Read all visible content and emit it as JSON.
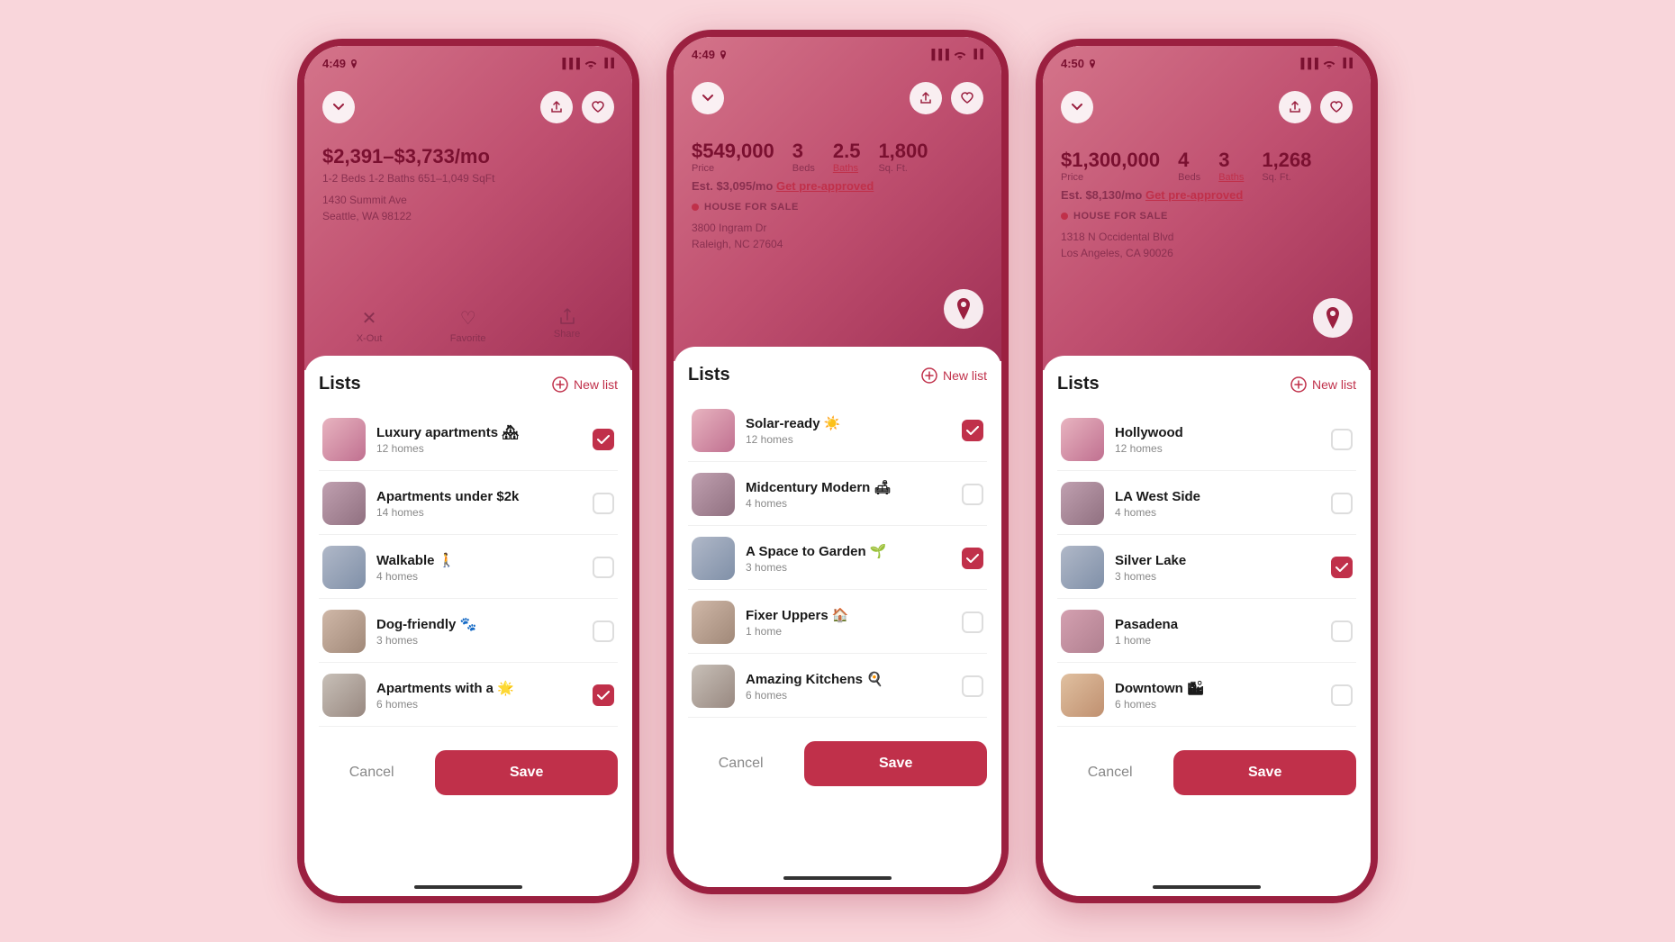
{
  "phones": [
    {
      "id": "phone-left",
      "status_time": "4:49",
      "property": {
        "price": "$2,391–$3,733/mo",
        "details": "1-2 Beds   1-2 Baths   651–1,049 SqFt",
        "address_line1": "1430 Summit Ave",
        "address_line2": "Seattle, WA 98122",
        "show_stats": false,
        "show_house_tag": false
      },
      "lists_title": "Lists",
      "new_list_label": "New list",
      "items": [
        {
          "name": "Luxury apartments 🏘",
          "count": "12 homes",
          "checked": true,
          "thumb": "thumb-gradient-1"
        },
        {
          "name": "Apartments under $2k",
          "count": "14 homes",
          "checked": false,
          "thumb": "thumb-gradient-2"
        },
        {
          "name": "Walkable 🚶",
          "count": "4 homes",
          "checked": false,
          "thumb": "thumb-gradient-3"
        },
        {
          "name": "Dog-friendly 🐾",
          "count": "3 homes",
          "checked": false,
          "thumb": "thumb-gradient-4"
        },
        {
          "name": "Apartments with a 🌟",
          "count": "6 homes",
          "checked": true,
          "thumb": "thumb-gradient-5"
        }
      ],
      "cancel_label": "Cancel",
      "save_label": "Save"
    },
    {
      "id": "phone-middle",
      "status_time": "4:49",
      "property": {
        "price": "$549,000",
        "show_stats": true,
        "beds": "3",
        "baths": "2.5",
        "sqft": "1,800",
        "est_payment": "Est. $3,095/mo",
        "get_approved": "Get pre-approved",
        "show_house_tag": true,
        "house_tag": "HOUSE FOR SALE",
        "address_line1": "3800 Ingram Dr",
        "address_line2": "Raleigh, NC 27604"
      },
      "lists_title": "Lists",
      "new_list_label": "New list",
      "items": [
        {
          "name": "Solar-ready ☀️",
          "count": "12 homes",
          "checked": true,
          "thumb": "thumb-gradient-1"
        },
        {
          "name": "Midcentury Modern 🛋",
          "count": "4 homes",
          "checked": false,
          "thumb": "thumb-gradient-2"
        },
        {
          "name": "A Space to Garden 🌱",
          "count": "3 homes",
          "checked": true,
          "thumb": "thumb-gradient-3"
        },
        {
          "name": "Fixer Uppers 🏠",
          "count": "1 home",
          "checked": false,
          "thumb": "thumb-gradient-4"
        },
        {
          "name": "Amazing Kitchens 🍳",
          "count": "6 homes",
          "checked": false,
          "thumb": "thumb-gradient-5"
        }
      ],
      "cancel_label": "Cancel",
      "save_label": "Save"
    },
    {
      "id": "phone-right",
      "status_time": "4:50",
      "property": {
        "price": "$1,300,000",
        "show_stats": true,
        "beds": "4",
        "baths": "3",
        "sqft": "1,268",
        "est_payment": "Est. $8,130/mo",
        "get_approved": "Get pre-approved",
        "show_house_tag": true,
        "house_tag": "HOUSE FOR SALE",
        "address_line1": "1318 N Occidental Blvd",
        "address_line2": "Los Angeles, CA 90026"
      },
      "lists_title": "Lists",
      "new_list_label": "New list",
      "items": [
        {
          "name": "Hollywood",
          "count": "12 homes",
          "checked": false,
          "thumb": "thumb-gradient-1"
        },
        {
          "name": "LA West Side",
          "count": "4 homes",
          "checked": false,
          "thumb": "thumb-gradient-2"
        },
        {
          "name": "Silver Lake",
          "count": "3 homes",
          "checked": true,
          "thumb": "thumb-gradient-3"
        },
        {
          "name": "Pasadena",
          "count": "1 home",
          "checked": false,
          "thumb": "thumb-gradient-6"
        },
        {
          "name": "Downtown 🏙",
          "count": "6 homes",
          "checked": false,
          "thumb": "thumb-gradient-7"
        }
      ],
      "cancel_label": "Cancel",
      "save_label": "Save"
    }
  ]
}
